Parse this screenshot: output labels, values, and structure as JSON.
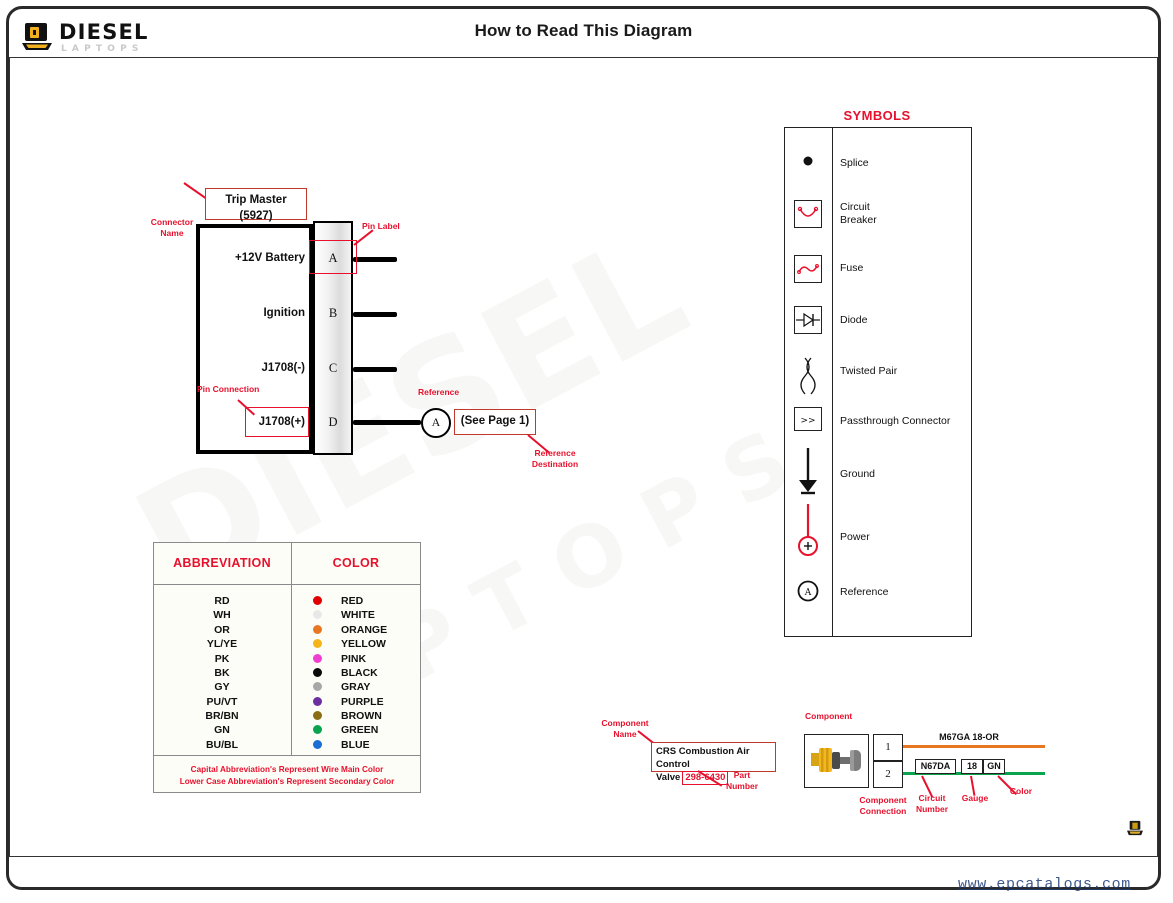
{
  "header": {
    "title": "How to Read This Diagram",
    "logo_text": "DIESEL",
    "logo_sub": "LAPTOPS"
  },
  "watermark_text": "DIESEL LAPTOPS",
  "connector": {
    "annotations": {
      "connector_name": "Connector\nName",
      "connector_name_l1": "Connector",
      "connector_name_l2": "Name",
      "pin_label": "Pin Label",
      "pin_connection": "Pin Connection",
      "reference": "Reference",
      "reference_destination_l1": "Reference",
      "reference_destination_l2": "Destination"
    },
    "name_line1": "Trip Master",
    "name_line2": "(5927)",
    "circuits": [
      {
        "label": "+12V Battery",
        "pin": "A"
      },
      {
        "label": "Ignition",
        "pin": "B"
      },
      {
        "label": "J1708(-)",
        "pin": "C"
      },
      {
        "label": "J1708(+)",
        "pin": "D"
      }
    ],
    "reference_letter": "A",
    "reference_destination": "(See Page 1)"
  },
  "symbols": {
    "title": "SYMBOLS",
    "items": [
      {
        "icon": "splice-dot-icon",
        "label": "Splice"
      },
      {
        "icon": "circuit-breaker-icon",
        "label": "Circuit\nBreaker",
        "label_l1": "Circuit",
        "label_l2": "Breaker"
      },
      {
        "icon": "fuse-icon",
        "label": "Fuse"
      },
      {
        "icon": "diode-icon",
        "label": "Diode"
      },
      {
        "icon": "twisted-pair-icon",
        "label": "Twisted Pair"
      },
      {
        "icon": "passthrough-connector-icon",
        "label": "Passthrough Connector",
        "glyph": ">>"
      },
      {
        "icon": "ground-icon",
        "label": "Ground"
      },
      {
        "icon": "power-icon",
        "label": "Power",
        "glyph": "+"
      },
      {
        "icon": "reference-icon",
        "label": "Reference",
        "glyph": "A"
      }
    ]
  },
  "color_table": {
    "headers": [
      "ABBREVIATION",
      "COLOR"
    ],
    "rows": [
      {
        "abbr": "RD",
        "color_name": "RED",
        "hex": "#e00000"
      },
      {
        "abbr": "WH",
        "color_name": "WHITE",
        "hex": "#e8e8e8"
      },
      {
        "abbr": "OR",
        "color_name": "ORANGE",
        "hex": "#e87722"
      },
      {
        "abbr": "YL/YE",
        "color_name": "YELLOW",
        "hex": "#f5b51a"
      },
      {
        "abbr": "PK",
        "color_name": "PINK",
        "hex": "#ee3fd0"
      },
      {
        "abbr": "BK",
        "color_name": "BLACK",
        "hex": "#0a0a0a"
      },
      {
        "abbr": "GY",
        "color_name": "GRAY",
        "hex": "#a8a8a8"
      },
      {
        "abbr": "PU/VT",
        "color_name": "PURPLE",
        "hex": "#6b2fa0"
      },
      {
        "abbr": "BR/BN",
        "color_name": "BROWN",
        "hex": "#8a6d14"
      },
      {
        "abbr": "GN",
        "color_name": "GREEN",
        "hex": "#0aa34f"
      },
      {
        "abbr": "BU/BL",
        "color_name": "BLUE",
        "hex": "#1a6fd4"
      }
    ],
    "footnote_line1": "Capital Abbreviation's Represent Wire Main Color",
    "footnote_line2": "Lower Case Abbreviation's Represent Secondary Color"
  },
  "component_example": {
    "annotations": {
      "component_name_l1": "Component",
      "component_name_l2": "Name",
      "part_number_l1": "Part",
      "part_number_l2": "Number",
      "component": "Component",
      "component_connection_l1": "Component",
      "component_connection_l2": "Connection",
      "circuit_number_l1": "Circuit",
      "circuit_number_l2": "Number",
      "gauge": "Gauge",
      "color": "Color"
    },
    "component_name_line1": "CRS Combustion Air Control",
    "component_name_line2": "Valve",
    "part_number": "298-6430",
    "pins": [
      "1",
      "2"
    ],
    "wire_top_label": "M67GA 18-OR",
    "wire_top_color": "#e87722",
    "wire_bottom": {
      "circuit_number": "N67DA",
      "gauge": "18",
      "color_code": "GN",
      "color": "#0aa34f"
    }
  },
  "footer": {
    "url": "www.epcatalogs.com"
  }
}
